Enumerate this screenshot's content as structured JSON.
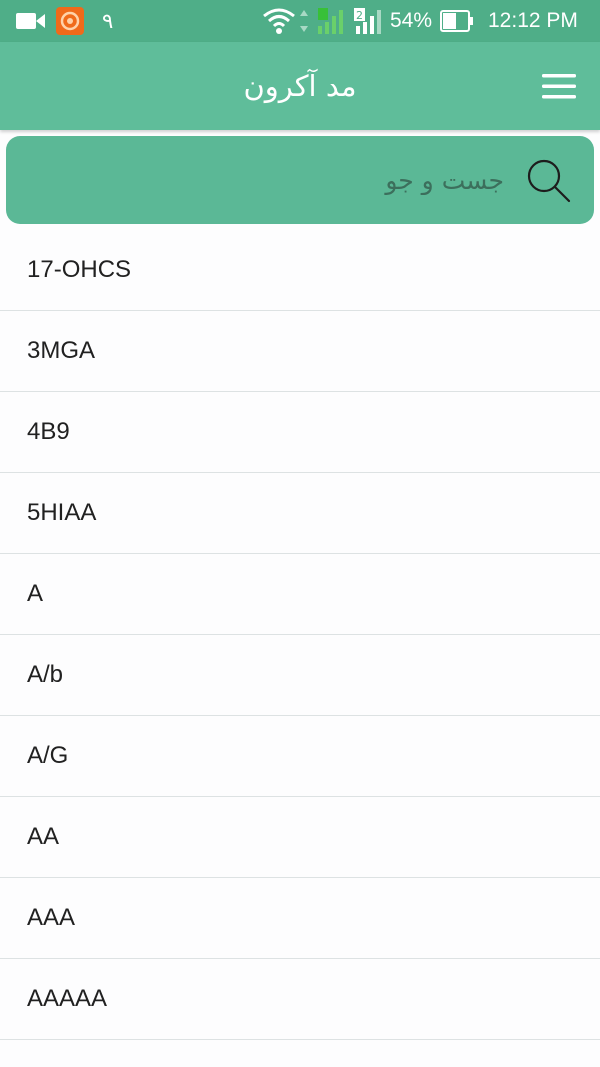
{
  "status_bar": {
    "background_color": "#4fae88",
    "left_icons": [
      "video-camera-icon",
      "app-notification-icon"
    ],
    "notification_digit": "۹",
    "right_icons": [
      "wifi-icon",
      "signal-sim1-icon",
      "signal-sim2-icon",
      "battery-icon"
    ],
    "battery_percent": "54%",
    "battery_level": 54,
    "time": "12:12 PM"
  },
  "app_bar": {
    "title": "مد آکرون",
    "menu_icon": "hamburger-menu-icon",
    "background_color": "#5fbd9a"
  },
  "search": {
    "placeholder": "جست و جو",
    "value": "",
    "icon": "search-icon",
    "background_color": "#5bb896"
  },
  "list": {
    "items": [
      "17-OHCS",
      "3MGA",
      "4B9",
      "5HIAA",
      "A",
      "A/b",
      "A/G",
      "AA",
      "AAA",
      "AAAAA"
    ]
  }
}
